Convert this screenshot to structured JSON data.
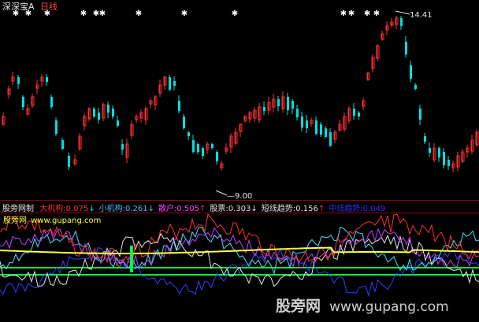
{
  "header": {
    "title": "深深宝A",
    "period": "日线"
  },
  "price_chart": {
    "high_label": "14.41",
    "low_label": "9.00"
  },
  "indicator_bar": {
    "name": "股旁网制",
    "items": [
      {
        "label": "大机构:",
        "value": "0.075",
        "arrow": "↓",
        "label_color": "#ff3030",
        "value_color": "#ff3030",
        "arrow_color": "#00e0ff"
      },
      {
        "label": "小机构:",
        "value": "0.261",
        "arrow": "↓",
        "label_color": "#40c0ff",
        "value_color": "#40c0ff",
        "arrow_color": "#40c0ff"
      },
      {
        "label": "散户:",
        "value": "0.505",
        "arrow": "↑",
        "label_color": "#ff40ff",
        "value_color": "#ff40ff",
        "arrow_color": "#ff3030"
      },
      {
        "label": "股票:",
        "value": "0.303",
        "arrow": "↓",
        "label_color": "#e0e0e0",
        "value_color": "#e0e0e0",
        "arrow_color": "#e0e0e0"
      },
      {
        "label": "短线趋势:",
        "value": "0.156",
        "arrow": "↑",
        "label_color": "#e0e0e0",
        "value_color": "#e0e0e0",
        "arrow_color": "#ff3030"
      },
      {
        "label": "中线趋势:",
        "value": "0.049",
        "arrow": "",
        "label_color": "#3030ff",
        "value_color": "#3030ff",
        "arrow_color": "#3030ff"
      }
    ]
  },
  "sub_tag": {
    "name": "股旁网",
    "url": "www.gupang.com"
  },
  "watermark": {
    "name": "股旁网",
    "url": "www.gupang.com"
  },
  "colors": {
    "up": "#ff3030",
    "down": "#00e0e0",
    "grid": "#8b0000",
    "yellow": "#ffff40",
    "green": "#00ff40",
    "purple": "#c040ff",
    "blue": "#3040ff",
    "cyan": "#40e0ff",
    "white": "#e6e6e6"
  }
}
